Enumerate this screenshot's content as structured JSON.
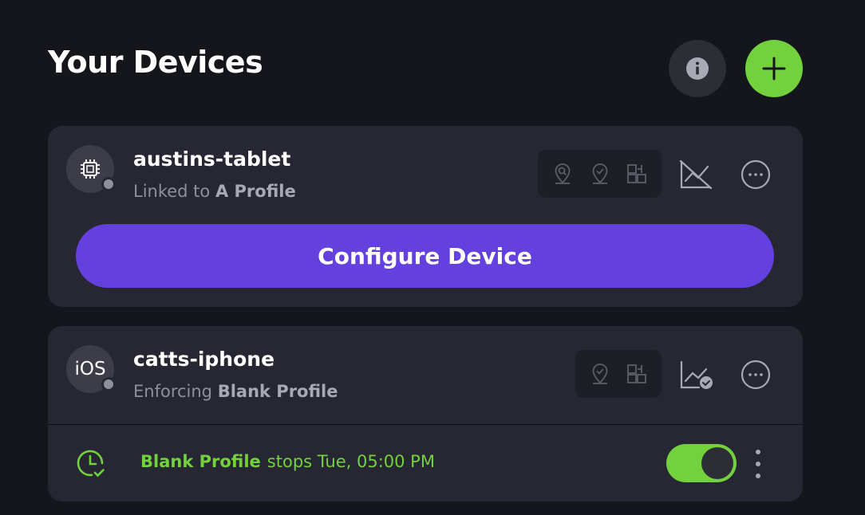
{
  "page": {
    "title": "Your Devices"
  },
  "header": {
    "info_icon": "info-icon",
    "add_icon": "plus-icon"
  },
  "devices": [
    {
      "name": "austins-tablet",
      "avatar_icon": "chip-icon",
      "status_prefix": "Linked to",
      "profile": "A Profile",
      "feature_icons": [
        "location-search-icon",
        "location-check-icon",
        "app-blocks-icon"
      ],
      "chart_icon": "chart-off-icon",
      "configure_label": "Configure Device"
    },
    {
      "name": "catts-iphone",
      "avatar_text": "iOS",
      "status_prefix": "Enforcing",
      "profile": "Blank Profile",
      "feature_icons": [
        "location-check-icon",
        "app-blocks-icon"
      ],
      "chart_icon": "chart-check-icon",
      "schedule": {
        "profile": "Blank Profile",
        "text": "stops Tue, 05:00 PM",
        "enabled": true
      }
    }
  ],
  "colors": {
    "background": "#15161c",
    "card": "#262733",
    "accent_green": "#72d13d",
    "accent_purple": "#6440de",
    "muted_text": "#8f909a"
  }
}
